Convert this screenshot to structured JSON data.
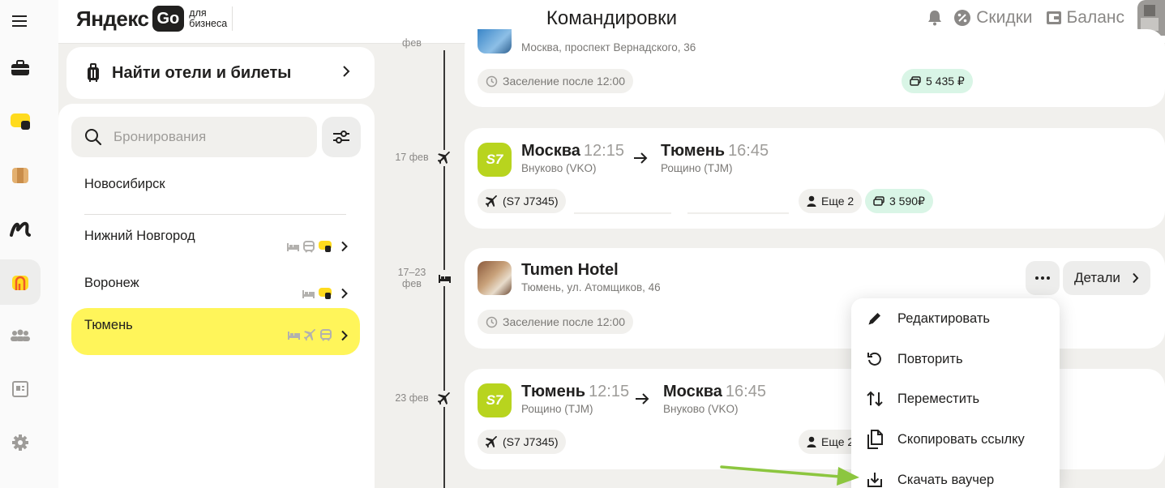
{
  "header": {
    "logo_main": "Яндекс",
    "logo_go": "Go",
    "logo_sub1": "для",
    "logo_sub2": "бизнеса",
    "title": "Командировки",
    "discounts": "Скидки",
    "balance": "Баланс"
  },
  "rail": {
    "items": [
      {
        "icon": "menu-icon"
      },
      {
        "icon": "briefcase-icon"
      },
      {
        "icon": "taxi-icon"
      },
      {
        "icon": "delivery-box-icon"
      },
      {
        "icon": "eats-icon"
      },
      {
        "icon": "trips-icon",
        "active": true
      },
      {
        "icon": "employees-icon"
      },
      {
        "icon": "reports-icon"
      },
      {
        "icon": "settings-icon"
      }
    ]
  },
  "left": {
    "find_label": "Найти отели и билеты",
    "search_placeholder": "Бронирования",
    "trips": [
      {
        "name": "Новосибирск"
      },
      {
        "name": "Нижний Новгород",
        "icons": [
          "hotel",
          "train",
          "taxi"
        ]
      },
      {
        "name": "Воронеж",
        "icons": [
          "hotel",
          "taxi"
        ]
      },
      {
        "name": "Тюмень",
        "icons": [
          "hotel",
          "plane",
          "train"
        ],
        "active": true
      }
    ]
  },
  "timeline": {
    "date_top": "фев",
    "date1": "17 фев",
    "date2_line1": "17–23",
    "date2_line2": "фев",
    "date3": "23 фев"
  },
  "cards": {
    "hotel_top": {
      "address": "Москва, проспект Вернадского, 36",
      "checkin": "Заселение после 12:00",
      "price": "5 435 ₽"
    },
    "flight1": {
      "from_city": "Москва",
      "from_time": "12:15",
      "from_airport": "Внуково (VKO)",
      "to_city": "Тюмень",
      "to_time": "16:45",
      "to_airport": "Рощино (TJM)",
      "flight": "(S7 J7345)",
      "more": "Еще 2",
      "price": "3 590₽"
    },
    "hotel": {
      "name": "Tumen Hotel",
      "address": "Тюмень, ул. Атомщиков, 46",
      "checkin": "Заселение после 12:00",
      "details": "Детали"
    },
    "flight2": {
      "from_city": "Тюмень",
      "from_time": "12:15",
      "from_airport": "Рощино (TJM)",
      "to_city": "Москва",
      "to_time": "16:45",
      "to_airport": "Внуково (VKO)",
      "flight": "(S7 J7345)",
      "more": "Еще 2"
    }
  },
  "airline_logo": "S7",
  "menu": {
    "items": [
      {
        "label": "Редактировать",
        "icon": "pencil-icon"
      },
      {
        "label": "Повторить",
        "icon": "repeat-icon"
      },
      {
        "label": "Переместить",
        "icon": "move-icon"
      },
      {
        "label": "Скопировать ссылку",
        "icon": "copy-icon"
      },
      {
        "label": "Скачать ваучер",
        "icon": "download-icon"
      }
    ]
  },
  "colors": {
    "accent_yellow": "#fff55a",
    "price_green": "#d9f5e6",
    "s7_green": "#b8d41e",
    "annotation_arrow": "#8cc63f"
  }
}
